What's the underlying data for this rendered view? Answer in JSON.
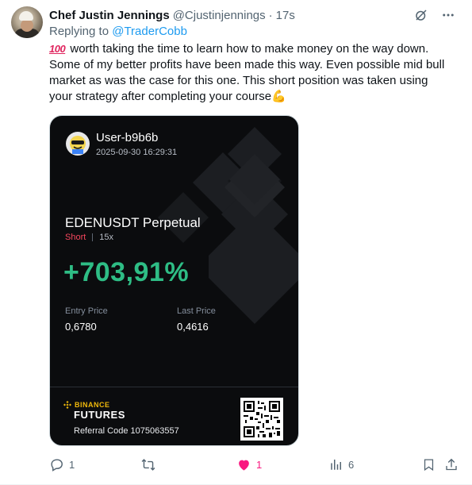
{
  "tweet": {
    "author_name": "Chef Justin Jennings",
    "author_handle": "@Cjustinjennings",
    "separator": "·",
    "time": "17s",
    "replying_prefix": "Replying to ",
    "replying_to": "@TraderCobb",
    "text_emoji": "100",
    "text": " worth taking the time to learn how to make money on the way down. Some of my better profits have been made this way. Even possible mid bull market as was the case for this one. This short position was taken using your strategy after completing your course",
    "text_end_emoji": "💪"
  },
  "card": {
    "username": "User-b9b6b",
    "timestamp": "2025-09-30 16:29:31",
    "pair": "EDENUSDT Perpetual",
    "side": "Short",
    "leverage": "15x",
    "roi": "+703,91%",
    "entry_label": "Entry Price",
    "entry_value": "0,6780",
    "last_label": "Last Price",
    "last_value": "0,4616",
    "brand_line1": "BINANCE",
    "brand_line2": "FUTURES",
    "referral": "Referral Code 1075063557",
    "colors": {
      "short": "#f6465d",
      "roi": "#2ebd85",
      "brand": "#f0b90b"
    }
  },
  "actions": {
    "replies": "1",
    "retweets": "",
    "likes": "1",
    "views": "6"
  },
  "icons": [
    "grok-icon",
    "more-icon",
    "reply-icon",
    "retweet-icon",
    "like-icon",
    "views-icon",
    "bookmark-icon",
    "share-icon",
    "binance-logo-icon",
    "qr-code-icon"
  ]
}
